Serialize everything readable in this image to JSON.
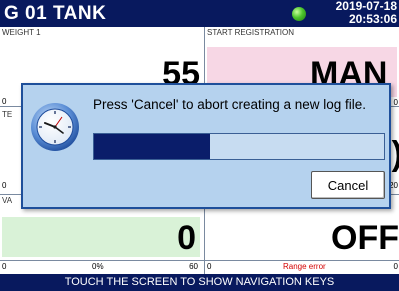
{
  "header": {
    "title": "G 01   TANK",
    "date": "2019-07-18",
    "time": "20:53:06"
  },
  "panels": {
    "weight": {
      "label": "WEIGHT 1",
      "value": "55",
      "scale_min": "0"
    },
    "start_registration": {
      "label": "START REGISTRATION",
      "value": "MAN",
      "scale_max": "0"
    },
    "middle_left": {
      "label": "TE",
      "scale_min": "0"
    },
    "middle_right": {
      "value": ")",
      "scale_max": "20"
    },
    "bottom_left": {
      "label": "VA",
      "value": "0",
      "scale_min": "0",
      "scale_mid": "0%",
      "scale_max": "60"
    },
    "bottom_right": {
      "value": "OFF",
      "scale_min": "0",
      "range_error": "Range error",
      "scale_max": "0"
    }
  },
  "footer": {
    "text": "TOUCH THE SCREEN TO SHOW NAVIGATION KEYS"
  },
  "dialog": {
    "message": "Press 'Cancel' to abort creating a new log file.",
    "icon": "clock-icon",
    "progress": 0.4,
    "cancel_label": "Cancel"
  },
  "colors": {
    "header_bg": "#08195e",
    "panel_green": "#d9f2d7",
    "panel_pink": "#f7d7e5",
    "dialog_bg": "#b5d2ee",
    "progress_fill": "#0a1d6a",
    "range_error": "#d40000"
  }
}
